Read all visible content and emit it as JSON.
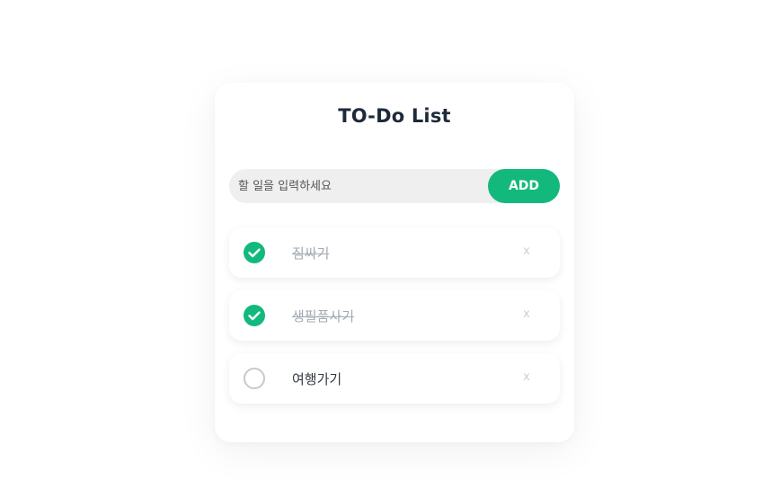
{
  "app": {
    "title": "TO-Do List"
  },
  "input": {
    "placeholder": "할 일을 입력하세요",
    "value": "",
    "add_label": "ADD"
  },
  "todos": [
    {
      "text": "짐싸기",
      "done": true,
      "delete_label": "x"
    },
    {
      "text": "생필품사기",
      "done": true,
      "delete_label": "x"
    },
    {
      "text": "여행가기",
      "done": false,
      "delete_label": "x"
    }
  ],
  "colors": {
    "accent": "#13b97c",
    "input_bg": "#efefef",
    "title": "#1e2a3a",
    "done_text": "#a3aab3"
  },
  "icons": {
    "checked": "checkmark-circle-icon",
    "unchecked": "empty-circle-icon"
  }
}
